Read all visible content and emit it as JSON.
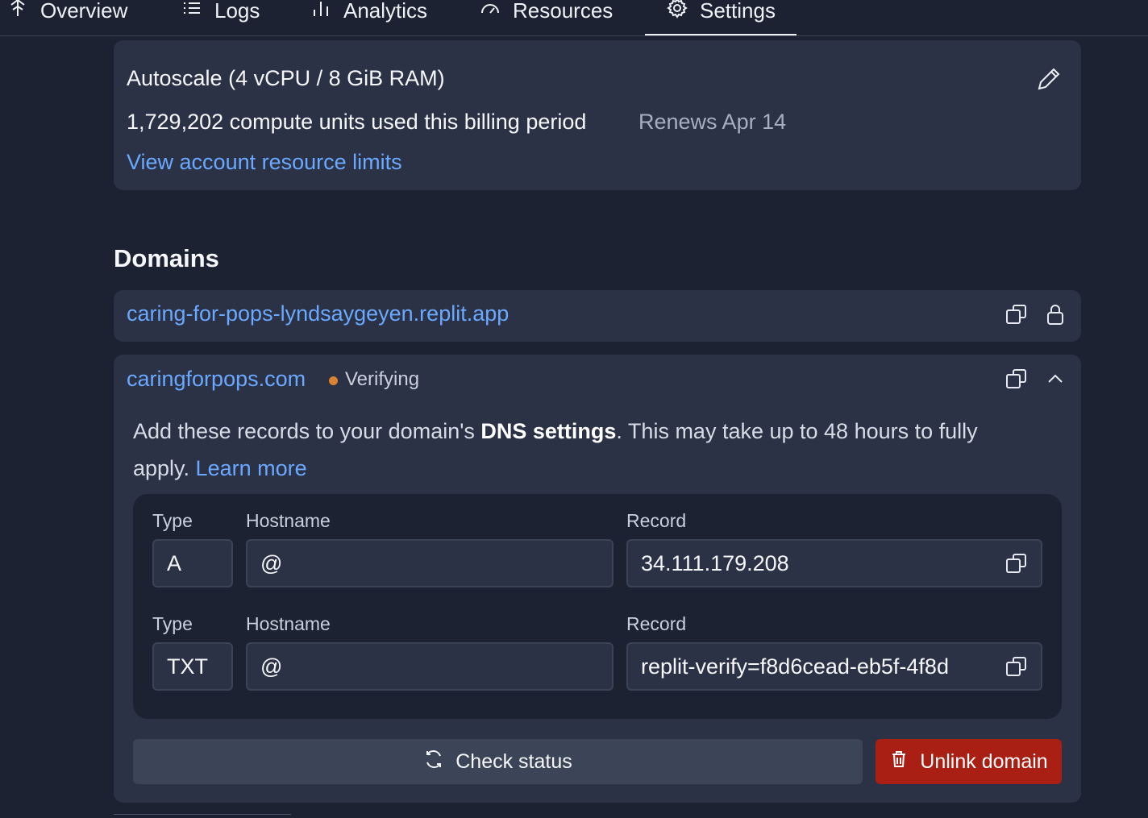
{
  "tabs": [
    {
      "label": "Overview",
      "icon": "overview-icon"
    },
    {
      "label": "Logs",
      "icon": "list-icon"
    },
    {
      "label": "Analytics",
      "icon": "bar-chart-icon"
    },
    {
      "label": "Resources",
      "icon": "gauge-icon"
    },
    {
      "label": "Settings",
      "icon": "gear-icon",
      "active": true
    }
  ],
  "plan": {
    "title": "Autoscale (4 vCPU / 8 GiB RAM)",
    "usage": "1,729,202 compute units used this billing period",
    "renews": "Renews Apr 14",
    "limits_link": "View account resource limits"
  },
  "domains": {
    "heading": "Domains",
    "primary": {
      "url": "caring-for-pops-lyndsaygeyen.replit.app"
    },
    "custom": {
      "url": "caringforpops.com",
      "status": "Verifying",
      "status_color": "#d98232",
      "desc_prefix": "Add these records to your domain's ",
      "desc_bold": "DNS settings",
      "desc_suffix": ". This may take up to 48 hours to fully apply. ",
      "learn_more": "Learn more",
      "labels": {
        "type": "Type",
        "hostname": "Hostname",
        "record": "Record"
      },
      "records": [
        {
          "type": "A",
          "hostname": "@",
          "record": "34.111.179.208"
        },
        {
          "type": "TXT",
          "hostname": "@",
          "record": "replit-verify=f8d6cead-eb5f-4f8d"
        }
      ],
      "check_status": "Check status",
      "unlink": "Unlink domain"
    }
  },
  "colors": {
    "accent": "#6aa9ff",
    "danger": "#a91f14",
    "background": "#1c2232",
    "card": "#2b3245"
  }
}
